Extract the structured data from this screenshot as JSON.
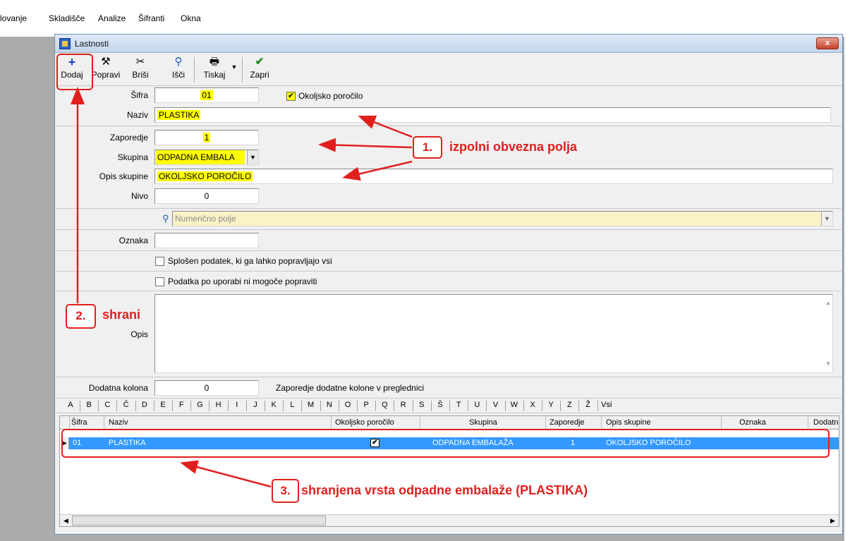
{
  "menu": [
    "lovanje",
    "Skladišče",
    "Analize",
    "Šifranti",
    "Okna"
  ],
  "window": {
    "title": "Lastnosti",
    "close": "x"
  },
  "toolbar": {
    "dodaj": "Dodaj",
    "popravi": "Popravi",
    "brisi": "Briši",
    "isci": "Išči",
    "tiskaj": "Tiskaj",
    "zapri": "Zapri"
  },
  "form": {
    "sifra_label": "Šifra",
    "sifra_value": "01",
    "okoljsko_label": "Okoljsko poročilo",
    "okoljsko_checked": true,
    "naziv_label": "Naziv",
    "naziv_value": "PLASTIKA",
    "zaporedje_label": "Zaporedje",
    "zaporedje_value": "1",
    "skupina_label": "Skupina",
    "skupina_value": "ODPADNA EMBALA",
    "opis_skupine_label": "Opis skupine",
    "opis_skupine_value": "OKOLJSKO POROČILO",
    "nivo_label": "Nivo",
    "nivo_value": "0",
    "numericno_placeholder": "Numerično polje",
    "oznaka_label": "Oznaka",
    "oznaka_value": "",
    "splosen_label": "Splošen podatek, ki ga lahko popravljajo vsi",
    "podatka_label": "Podatka po uporabi ni mogoče popraviti",
    "opis_label": "Opis",
    "dodatna_label": "Dodatna kolona",
    "dodatna_value": "0",
    "dodatna_desc": "Zaporedje dodatne kolone v preglednici"
  },
  "alphabet": [
    "A",
    "B",
    "C",
    "Č",
    "D",
    "E",
    "F",
    "G",
    "H",
    "I",
    "J",
    "K",
    "L",
    "M",
    "N",
    "O",
    "P",
    "Q",
    "R",
    "S",
    "Š",
    "T",
    "U",
    "V",
    "W",
    "X",
    "Y",
    "Z",
    "Ž",
    "Vsi"
  ],
  "grid": {
    "headers": [
      "Šifra",
      "Naziv",
      "Okoljsko poročilo",
      "Skupina",
      "Zaporedje",
      "Opis skupine",
      "Oznaka",
      "Dodatn"
    ],
    "row": {
      "sifra": "01",
      "naziv": "PLASTIKA",
      "okoljsko": true,
      "skupina": "ODPADNA EMBALAŽA",
      "zaporedje": "1",
      "opis_skupine": "OKOLJSKO POROČILO",
      "oznaka": ""
    }
  },
  "annotations": {
    "n1": "1.",
    "t1": "izpolni obvezna polja",
    "n2": "2.",
    "t2": "shrani",
    "n3": "3.",
    "t3": "shranjena vrsta odpadne embalaže (PLASTIKA)"
  },
  "colors": {
    "annotation": "#e0201e",
    "highlight": "#ffff00",
    "selection": "#3399ff"
  }
}
